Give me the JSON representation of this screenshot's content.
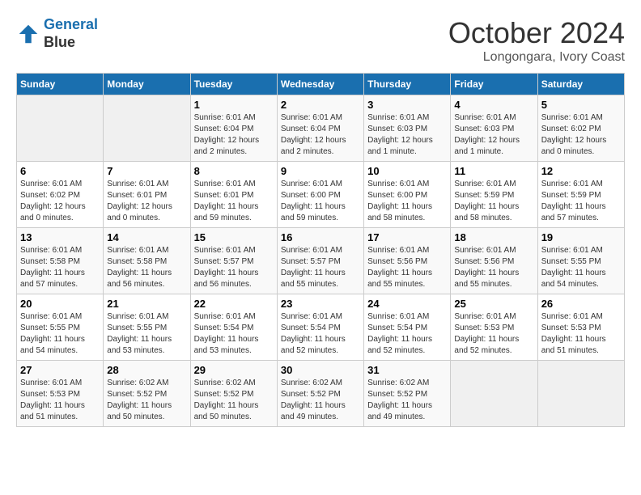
{
  "header": {
    "logo_line1": "General",
    "logo_line2": "Blue",
    "month": "October 2024",
    "location": "Longongara, Ivory Coast"
  },
  "weekdays": [
    "Sunday",
    "Monday",
    "Tuesday",
    "Wednesday",
    "Thursday",
    "Friday",
    "Saturday"
  ],
  "weeks": [
    [
      {
        "day": "",
        "sunrise": "",
        "sunset": "",
        "daylight": ""
      },
      {
        "day": "",
        "sunrise": "",
        "sunset": "",
        "daylight": ""
      },
      {
        "day": "1",
        "sunrise": "Sunrise: 6:01 AM",
        "sunset": "Sunset: 6:04 PM",
        "daylight": "Daylight: 12 hours and 2 minutes."
      },
      {
        "day": "2",
        "sunrise": "Sunrise: 6:01 AM",
        "sunset": "Sunset: 6:04 PM",
        "daylight": "Daylight: 12 hours and 2 minutes."
      },
      {
        "day": "3",
        "sunrise": "Sunrise: 6:01 AM",
        "sunset": "Sunset: 6:03 PM",
        "daylight": "Daylight: 12 hours and 1 minute."
      },
      {
        "day": "4",
        "sunrise": "Sunrise: 6:01 AM",
        "sunset": "Sunset: 6:03 PM",
        "daylight": "Daylight: 12 hours and 1 minute."
      },
      {
        "day": "5",
        "sunrise": "Sunrise: 6:01 AM",
        "sunset": "Sunset: 6:02 PM",
        "daylight": "Daylight: 12 hours and 0 minutes."
      }
    ],
    [
      {
        "day": "6",
        "sunrise": "Sunrise: 6:01 AM",
        "sunset": "Sunset: 6:02 PM",
        "daylight": "Daylight: 12 hours and 0 minutes."
      },
      {
        "day": "7",
        "sunrise": "Sunrise: 6:01 AM",
        "sunset": "Sunset: 6:01 PM",
        "daylight": "Daylight: 12 hours and 0 minutes."
      },
      {
        "day": "8",
        "sunrise": "Sunrise: 6:01 AM",
        "sunset": "Sunset: 6:01 PM",
        "daylight": "Daylight: 11 hours and 59 minutes."
      },
      {
        "day": "9",
        "sunrise": "Sunrise: 6:01 AM",
        "sunset": "Sunset: 6:00 PM",
        "daylight": "Daylight: 11 hours and 59 minutes."
      },
      {
        "day": "10",
        "sunrise": "Sunrise: 6:01 AM",
        "sunset": "Sunset: 6:00 PM",
        "daylight": "Daylight: 11 hours and 58 minutes."
      },
      {
        "day": "11",
        "sunrise": "Sunrise: 6:01 AM",
        "sunset": "Sunset: 5:59 PM",
        "daylight": "Daylight: 11 hours and 58 minutes."
      },
      {
        "day": "12",
        "sunrise": "Sunrise: 6:01 AM",
        "sunset": "Sunset: 5:59 PM",
        "daylight": "Daylight: 11 hours and 57 minutes."
      }
    ],
    [
      {
        "day": "13",
        "sunrise": "Sunrise: 6:01 AM",
        "sunset": "Sunset: 5:58 PM",
        "daylight": "Daylight: 11 hours and 57 minutes."
      },
      {
        "day": "14",
        "sunrise": "Sunrise: 6:01 AM",
        "sunset": "Sunset: 5:58 PM",
        "daylight": "Daylight: 11 hours and 56 minutes."
      },
      {
        "day": "15",
        "sunrise": "Sunrise: 6:01 AM",
        "sunset": "Sunset: 5:57 PM",
        "daylight": "Daylight: 11 hours and 56 minutes."
      },
      {
        "day": "16",
        "sunrise": "Sunrise: 6:01 AM",
        "sunset": "Sunset: 5:57 PM",
        "daylight": "Daylight: 11 hours and 55 minutes."
      },
      {
        "day": "17",
        "sunrise": "Sunrise: 6:01 AM",
        "sunset": "Sunset: 5:56 PM",
        "daylight": "Daylight: 11 hours and 55 minutes."
      },
      {
        "day": "18",
        "sunrise": "Sunrise: 6:01 AM",
        "sunset": "Sunset: 5:56 PM",
        "daylight": "Daylight: 11 hours and 55 minutes."
      },
      {
        "day": "19",
        "sunrise": "Sunrise: 6:01 AM",
        "sunset": "Sunset: 5:55 PM",
        "daylight": "Daylight: 11 hours and 54 minutes."
      }
    ],
    [
      {
        "day": "20",
        "sunrise": "Sunrise: 6:01 AM",
        "sunset": "Sunset: 5:55 PM",
        "daylight": "Daylight: 11 hours and 54 minutes."
      },
      {
        "day": "21",
        "sunrise": "Sunrise: 6:01 AM",
        "sunset": "Sunset: 5:55 PM",
        "daylight": "Daylight: 11 hours and 53 minutes."
      },
      {
        "day": "22",
        "sunrise": "Sunrise: 6:01 AM",
        "sunset": "Sunset: 5:54 PM",
        "daylight": "Daylight: 11 hours and 53 minutes."
      },
      {
        "day": "23",
        "sunrise": "Sunrise: 6:01 AM",
        "sunset": "Sunset: 5:54 PM",
        "daylight": "Daylight: 11 hours and 52 minutes."
      },
      {
        "day": "24",
        "sunrise": "Sunrise: 6:01 AM",
        "sunset": "Sunset: 5:54 PM",
        "daylight": "Daylight: 11 hours and 52 minutes."
      },
      {
        "day": "25",
        "sunrise": "Sunrise: 6:01 AM",
        "sunset": "Sunset: 5:53 PM",
        "daylight": "Daylight: 11 hours and 52 minutes."
      },
      {
        "day": "26",
        "sunrise": "Sunrise: 6:01 AM",
        "sunset": "Sunset: 5:53 PM",
        "daylight": "Daylight: 11 hours and 51 minutes."
      }
    ],
    [
      {
        "day": "27",
        "sunrise": "Sunrise: 6:01 AM",
        "sunset": "Sunset: 5:53 PM",
        "daylight": "Daylight: 11 hours and 51 minutes."
      },
      {
        "day": "28",
        "sunrise": "Sunrise: 6:02 AM",
        "sunset": "Sunset: 5:52 PM",
        "daylight": "Daylight: 11 hours and 50 minutes."
      },
      {
        "day": "29",
        "sunrise": "Sunrise: 6:02 AM",
        "sunset": "Sunset: 5:52 PM",
        "daylight": "Daylight: 11 hours and 50 minutes."
      },
      {
        "day": "30",
        "sunrise": "Sunrise: 6:02 AM",
        "sunset": "Sunset: 5:52 PM",
        "daylight": "Daylight: 11 hours and 49 minutes."
      },
      {
        "day": "31",
        "sunrise": "Sunrise: 6:02 AM",
        "sunset": "Sunset: 5:52 PM",
        "daylight": "Daylight: 11 hours and 49 minutes."
      },
      {
        "day": "",
        "sunrise": "",
        "sunset": "",
        "daylight": ""
      },
      {
        "day": "",
        "sunrise": "",
        "sunset": "",
        "daylight": ""
      }
    ]
  ]
}
